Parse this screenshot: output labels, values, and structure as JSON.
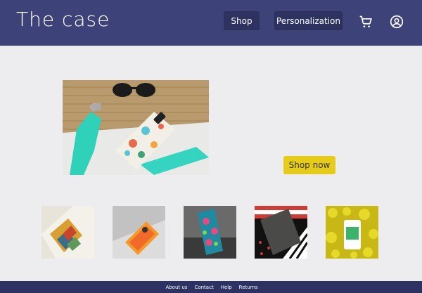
{
  "brand": {
    "title": "The case"
  },
  "nav": {
    "shop_label": "Shop",
    "personalization_label": "Personalization"
  },
  "icons": {
    "cart": "shopping-cart-icon",
    "account": "account-circle-icon"
  },
  "hero": {
    "cta_label": "Shop now"
  },
  "footer": {
    "links": [
      "About us",
      "Contact",
      "Help",
      "Returns"
    ]
  },
  "colors": {
    "header": "#3d4278",
    "background": "#ededf0",
    "cta": "#e6cc18",
    "footer": "#2e3263"
  }
}
